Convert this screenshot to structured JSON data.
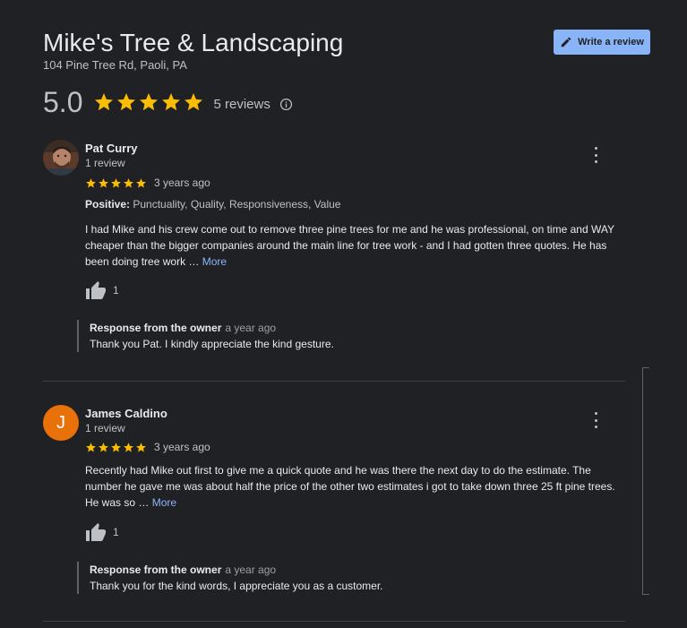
{
  "business": {
    "name": "Mike's Tree & Landscaping",
    "address": "104 Pine Tree Rd, Paoli, PA",
    "write_review_label": "Write a review",
    "rating": "5.0",
    "star_count": 5,
    "reviews_label": "5 reviews"
  },
  "colors": {
    "star": "#fbbc04",
    "accent": "#8ab4f8",
    "avatar_letter_bg": "#e8710a"
  },
  "reviews": [
    {
      "name": "Pat Curry",
      "meta": "1 review",
      "stars": 5,
      "time": "3 years ago",
      "attributes_label": "Positive:",
      "attributes": "Punctuality, Quality, Responsiveness, Value",
      "text": "I had Mike and his crew come out to remove three pine trees for me and he was professional, on time and WAY cheaper than the bigger companies around the main line for tree work - and I had gotten three quotes. He has been doing tree work … ",
      "more_label": "More",
      "likes": "1",
      "owner_title": "Response from the owner",
      "owner_time": "a year ago",
      "owner_text": "Thank you Pat. I kindly appreciate the kind gesture.",
      "avatar_icon": "profile-photo"
    },
    {
      "name": "James Caldino",
      "meta": "1 review",
      "stars": 5,
      "time": "3 years ago",
      "text": "Recently had Mike out first to give me a quick quote and he was there the next day to do the estimate. The number he gave me was about half the price of the other two estimates i got to take down three 25 ft pine trees. He was so … ",
      "more_label": "More",
      "likes": "1",
      "owner_title": "Response from the owner",
      "owner_time": "a year ago",
      "owner_text": "Thank you for the kind words, I appreciate you as a customer.",
      "avatar_letter": "J"
    }
  ]
}
